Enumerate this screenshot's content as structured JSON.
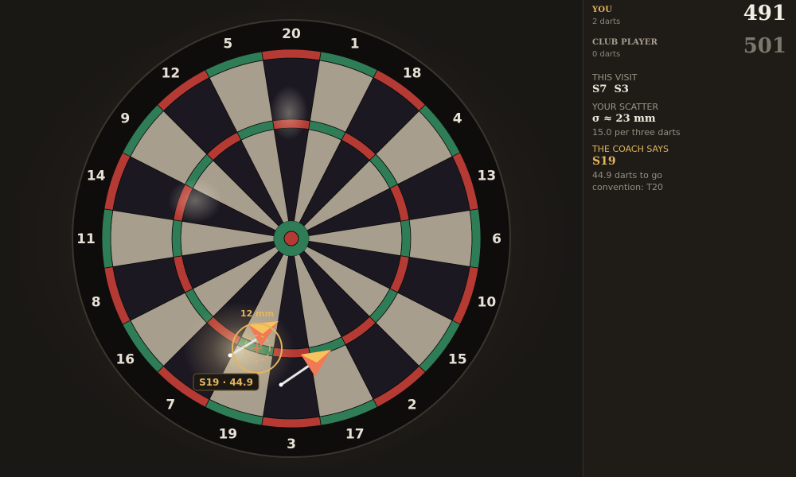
{
  "board": {
    "numbers": [
      20,
      1,
      18,
      4,
      13,
      6,
      10,
      15,
      2,
      17,
      3,
      19,
      7,
      16,
      8,
      11,
      14,
      9,
      12,
      5
    ],
    "colors": {
      "dark_segment": "#1b1822",
      "light_segment": "#a89e8e",
      "red_ring": "#b53a34",
      "green_ring": "#2f7d57",
      "surround": "#0e0d0c",
      "number_text": "#e8e2d6",
      "accent": "#e3b55c"
    },
    "aim_readout": "12 mm",
    "aim_tooltip": "S19 · 44.9"
  },
  "players": [
    {
      "name": "YOU",
      "darts": "2 darts",
      "score": "491"
    },
    {
      "name": "CLUB PLAYER",
      "darts": "0 darts",
      "score": "501"
    }
  ],
  "visit": {
    "label": "THIS VISIT",
    "value": "S7  S3"
  },
  "scatter": {
    "label": "YOUR SCATTER",
    "value": "σ ≈ 23 mm",
    "sub": "15.0 per three darts"
  },
  "coach": {
    "label": "THE COACH SAYS",
    "value": "S19",
    "sub1": "44.9 darts to go",
    "sub2": "convention: T20"
  }
}
